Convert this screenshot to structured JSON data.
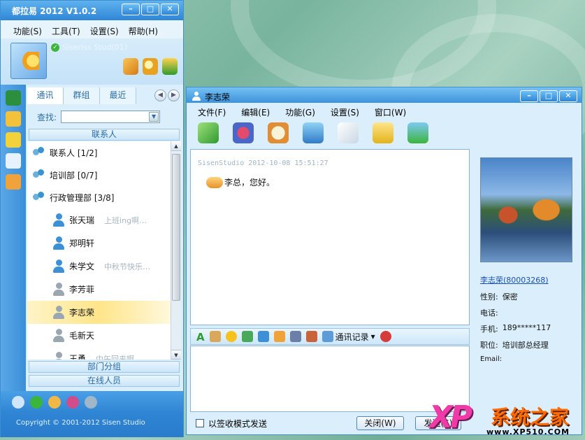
{
  "main_window": {
    "title": "都拉易 2012 V1.0.2",
    "menu": [
      "功能(S)",
      "工具(T)",
      "设置(S)",
      "帮助(H)"
    ],
    "user_status": "Siseriss Stud(01)",
    "tabs": [
      "通讯",
      "群组",
      "最近"
    ],
    "search_label": "查找:",
    "search_value": "",
    "section_contacts": "联系人",
    "groups": [
      {
        "label": "联系人 [1/2]"
      },
      {
        "label": "培训部 [0/7]"
      },
      {
        "label": "行政管理部 [3/8]"
      }
    ],
    "people": [
      {
        "name": "张天瑞",
        "status": "上班ing啊…",
        "online": true
      },
      {
        "name": "郑明轩",
        "status": "",
        "online": true
      },
      {
        "name": "朱学文",
        "status": "中秋节快乐…",
        "online": true
      },
      {
        "name": "李芳菲",
        "status": "",
        "online": false
      },
      {
        "name": "李志荣",
        "status": "",
        "online": false
      },
      {
        "name": "毛新天",
        "status": "",
        "online": false
      },
      {
        "name": "王勇",
        "status": "中午回来啊",
        "online": false
      }
    ],
    "section_dept": "部门分组",
    "section_online": "在线人员",
    "copyright": "Copyright © 2001-2012 Sisen Studio"
  },
  "chat_window": {
    "title": "李志荣",
    "menu": [
      "文件(F)",
      "编辑(E)",
      "功能(G)",
      "设置(S)",
      "窗口(W)"
    ],
    "message_header": "SisenStudio  2012-10-08 15:51:27",
    "message_text": "李总，您好。",
    "history_label": "通讯记录",
    "receipt_label": "以签收模式发送",
    "close_label": "关闭(W)",
    "send_label": "发送(S)",
    "profile": {
      "name": "李志荣(80003268)",
      "gender_label": "性别:",
      "gender": "保密",
      "phone_label": "电话:",
      "phone": "",
      "mobile_label": "手机:",
      "mobile": "189*****117",
      "position_label": "职位:",
      "position": "培训部总经理",
      "email_label": "Email:",
      "email": ""
    }
  },
  "watermark": {
    "logo": "XP",
    "brand": "系统之家",
    "url": "www.XP510.COM"
  },
  "colors": {
    "window_blue": "#3d8fd0",
    "selected_row": "#ffe58a",
    "panel_bg": "#dbeefb"
  }
}
